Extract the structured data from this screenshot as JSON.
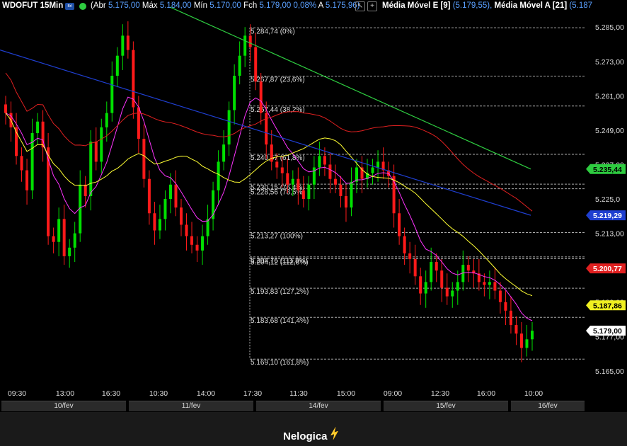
{
  "header": {
    "ticker": "WDOFUT 15Min",
    "badge": "Brl",
    "ohlc_prefix": "(Abr",
    "open": "5.175,00",
    "high_label": "Máx",
    "high": "5.184,00",
    "low_label": "Mín",
    "low": "5.170,00",
    "close_label": "Fch",
    "close": "5.179,00 0,08%",
    "avg_label": "A",
    "avg": "5.175,96)",
    "btn1": "↖",
    "btn2": "+",
    "ma_e_label": "Média Móvel E [9]",
    "ma_e_value": "(5.179,55),",
    "ma_a_label": "Média Móvel A [21]",
    "ma_a_value": "(5.187"
  },
  "price_axis": {
    "ticks": [
      "5.285,00",
      "5.273,00",
      "5.261,00",
      "5.249,00",
      "5.237,00",
      "5.225,0",
      "5.213,00",
      "5.201,00",
      "5.189,00",
      "5.177,00",
      "5.165,00"
    ],
    "markers": [
      {
        "label": "5.235,44",
        "color": "#2ecc40",
        "text_color": "#000"
      },
      {
        "label": "5.219,29",
        "color": "#1f3fd0",
        "text_color": "#fff"
      },
      {
        "label": "5.200,77",
        "color": "#e02020",
        "text_color": "#fff"
      },
      {
        "label": "5.187,86",
        "color": "#f0f020",
        "text_color": "#000"
      },
      {
        "label": "5.179,00",
        "color": "#ffffff",
        "text_color": "#000"
      }
    ]
  },
  "fibonacci": [
    {
      "label": "5.284,74 (0%)",
      "price": 5284.74
    },
    {
      "label": "5.267,87 (23,6%)",
      "price": 5267.87
    },
    {
      "label": "5.257,44 (38,2%)",
      "price": 5257.44
    },
    {
      "label": "5.240,57 (61,8%)",
      "price": 5240.57
    },
    {
      "label": "5.230,15 (76,4%)",
      "price": 5230.15
    },
    {
      "label": "5.228,56 (78,6%)",
      "price": 5228.56
    },
    {
      "label": "5.213,27 (100%)",
      "price": 5213.27
    },
    {
      "label": "5.204,76 (111,8%)",
      "price": 5204.76
    },
    {
      "label": "5.204,12 (112,8%)",
      "price": 5204.12
    },
    {
      "label": "5.193,83 (127,2%)",
      "price": 5193.83
    },
    {
      "label": "5.183,68 (141,4%)",
      "price": 5183.68
    },
    {
      "label": "5.169,10 (161,8%)",
      "price": 5169.1
    }
  ],
  "time_axis": {
    "labels": [
      "09:30",
      "13:00",
      "16:30",
      "10:30",
      "14:00",
      "17:30",
      "11:30",
      "15:00",
      "09:00",
      "12:30",
      "16:00",
      "10:00"
    ],
    "dates": [
      "10/fev",
      "11/fev",
      "14/fev",
      "15/fev",
      "16/fev"
    ]
  },
  "footer": {
    "brand": "Nelogica"
  },
  "chart_data": {
    "type": "candlestick",
    "instrument": "WDOFUT",
    "timeframe": "15Min",
    "y_range": [
      5161,
      5290
    ],
    "price_ticks": [
      5285,
      5273,
      5261,
      5249,
      5237,
      5225,
      5213,
      5201,
      5189,
      5177,
      5165
    ],
    "closes": [
      5255,
      5250,
      5240,
      5235,
      5228,
      5248,
      5252,
      5243,
      5212,
      5210,
      5218,
      5205,
      5208,
      5213,
      5230,
      5226,
      5245,
      5238,
      5250,
      5255,
      5268,
      5275,
      5282,
      5277,
      5257,
      5246,
      5232,
      5220,
      5214,
      5218,
      5225,
      5230,
      5222,
      5216,
      5212,
      5209,
      5207,
      5212,
      5218,
      5228,
      5238,
      5244,
      5256,
      5268,
      5275,
      5282,
      5278,
      5266,
      5255,
      5244,
      5238,
      5236,
      5234,
      5230,
      5232,
      5228,
      5225,
      5230,
      5236,
      5240,
      5237,
      5232,
      5230,
      5226,
      5222,
      5231,
      5236,
      5232,
      5234,
      5236,
      5238,
      5235,
      5233,
      5220,
      5212,
      5206,
      5204,
      5198,
      5192,
      5196,
      5203,
      5200,
      5194,
      5191,
      5193,
      5196,
      5202,
      5200,
      5199,
      5196,
      5195,
      5196,
      5193,
      5189,
      5186,
      5181,
      5178,
      5173,
      5176,
      5179
    ],
    "series": [
      {
        "name": "Média Móvel E [9]",
        "color": "#ff33ff",
        "last": "5.179,55"
      },
      {
        "name": "Média Móvel A [21]",
        "color": "#ffff33",
        "last": "5.187,86"
      }
    ],
    "other_lines": [
      {
        "color": "#2ecc40",
        "last": "5.235,44"
      },
      {
        "color": "#1f3fd0",
        "last": "5.219,29"
      },
      {
        "color": "#e02020",
        "last": "5.200,77"
      }
    ]
  }
}
